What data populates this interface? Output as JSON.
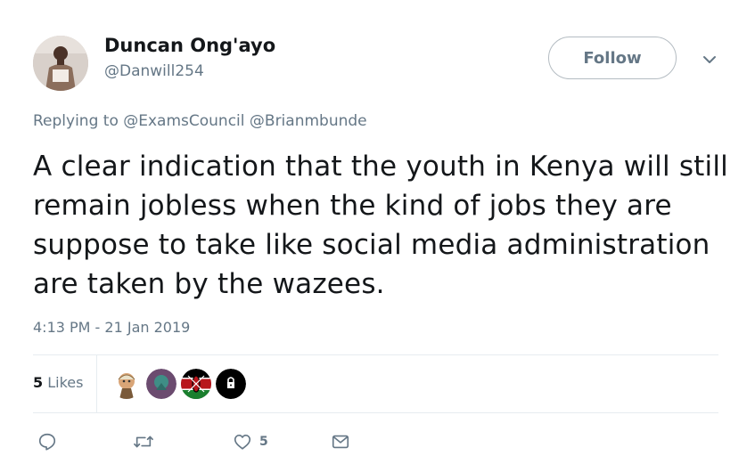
{
  "author": {
    "display_name": "Duncan Ong'ayo",
    "handle": "@Danwill254"
  },
  "follow_button": {
    "label": "Follow"
  },
  "reply_context": {
    "prefix": "Replying to",
    "mentions": [
      "@ExamsCouncil",
      "@Brianmbunde"
    ]
  },
  "tweet": {
    "text": "A clear indication that the youth in Kenya will still remain jobless when the kind of jobs they are suppose to take like social media administration are taken by the wazees.",
    "timestamp": "4:13 PM - 21 Jan 2019"
  },
  "stats": {
    "likes_count": "5",
    "likes_label": "Likes"
  },
  "actions": {
    "reply_icon": "reply-icon",
    "retweet_icon": "retweet-icon",
    "like_icon": "heart-icon",
    "like_count": "5",
    "dm_icon": "envelope-icon"
  },
  "colors": {
    "text": "#14171a",
    "muted": "#657786",
    "border": "#e6ecf0"
  }
}
